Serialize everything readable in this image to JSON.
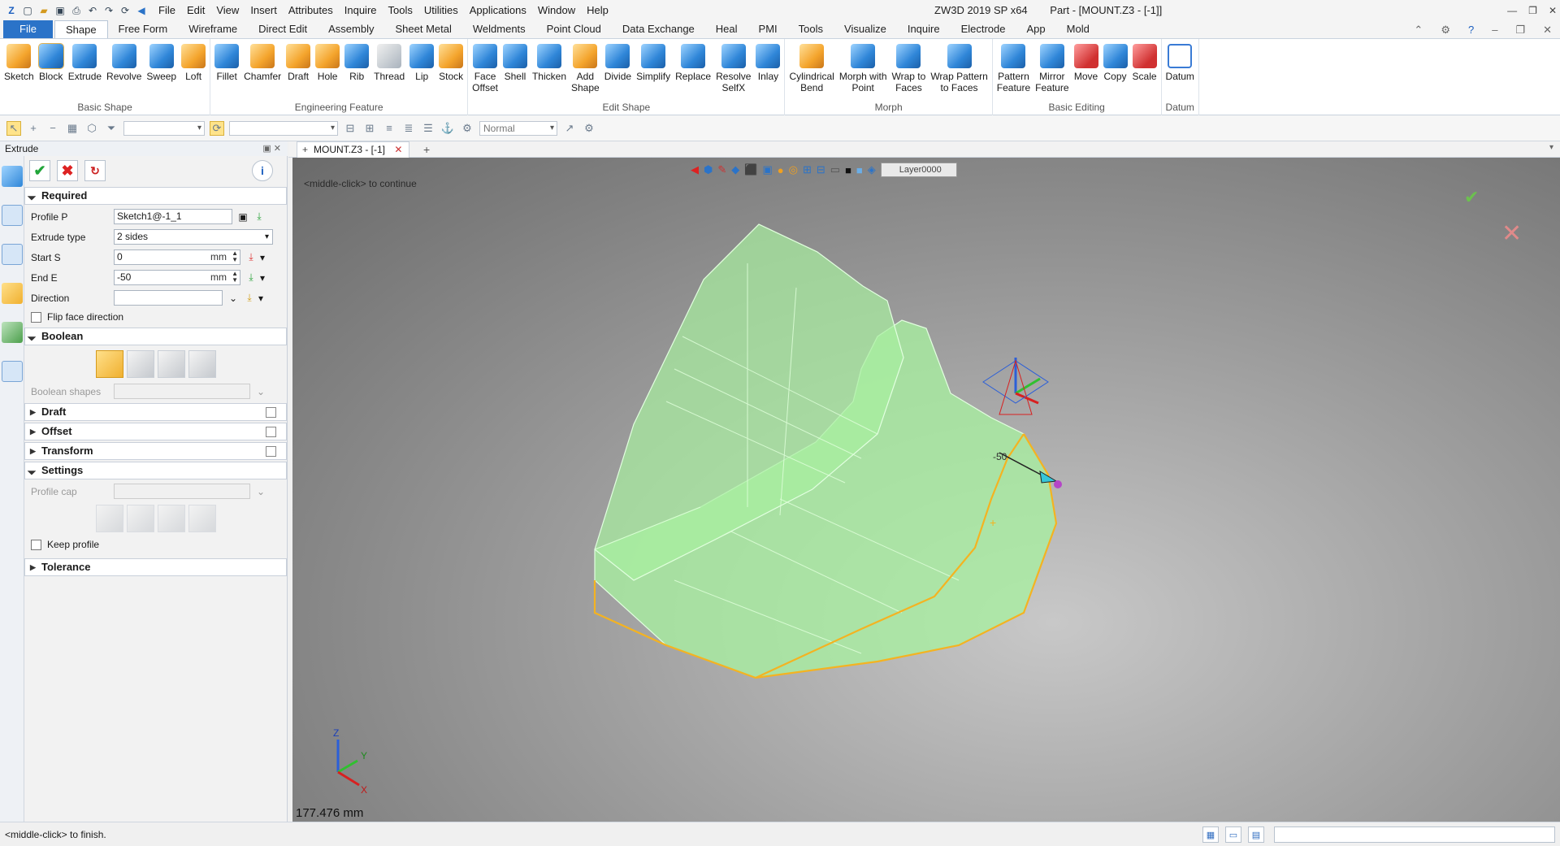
{
  "app": {
    "window_title": "ZW3D 2019 SP x64",
    "doc_title": "Part - [MOUNT.Z3 - [-1]]"
  },
  "menu": [
    "File",
    "Edit",
    "View",
    "Insert",
    "Attributes",
    "Inquire",
    "Tools",
    "Utilities",
    "Applications",
    "Window",
    "Help"
  ],
  "tabs": [
    "File",
    "Shape",
    "Free Form",
    "Wireframe",
    "Direct Edit",
    "Assembly",
    "Sheet Metal",
    "Weldments",
    "Point Cloud",
    "Data Exchange",
    "Heal",
    "PMI",
    "Tools",
    "Visualize",
    "Inquire",
    "Electrode",
    "App",
    "Mold"
  ],
  "ribbon": {
    "groups": [
      {
        "label": "Basic Shape",
        "buttons": [
          {
            "label": "Sketch",
            "icon": "sketch-icon",
            "color": "orange"
          },
          {
            "label": "Block",
            "icon": "block-icon",
            "color": "blue"
          },
          {
            "label": "Extrude",
            "icon": "extrude-icon",
            "color": "blue"
          },
          {
            "label": "Revolve",
            "icon": "revolve-icon",
            "color": "blue"
          },
          {
            "label": "Sweep",
            "icon": "sweep-icon",
            "color": "blue"
          },
          {
            "label": "Loft",
            "icon": "loft-icon",
            "color": "orange"
          }
        ]
      },
      {
        "label": "Engineering Feature",
        "buttons": [
          {
            "label": "Fillet",
            "icon": "fillet-icon",
            "color": "blue"
          },
          {
            "label": "Chamfer",
            "icon": "chamfer-icon",
            "color": "orange"
          },
          {
            "label": "Draft",
            "icon": "draft-icon",
            "color": "orange"
          },
          {
            "label": "Hole",
            "icon": "hole-icon",
            "color": "orange"
          },
          {
            "label": "Rib",
            "icon": "rib-icon",
            "color": "blue"
          },
          {
            "label": "Thread",
            "icon": "thread-icon",
            "color": "grey"
          },
          {
            "label": "Lip",
            "icon": "lip-icon",
            "color": "blue"
          },
          {
            "label": "Stock",
            "icon": "stock-icon",
            "color": "orange"
          }
        ]
      },
      {
        "label": "Edit Shape",
        "buttons": [
          {
            "label": "Face\nOffset",
            "icon": "face-offset-icon",
            "color": "blue"
          },
          {
            "label": "Shell",
            "icon": "shell-icon",
            "color": "blue"
          },
          {
            "label": "Thicken",
            "icon": "thicken-icon",
            "color": "blue"
          },
          {
            "label": "Add\nShape",
            "icon": "add-shape-icon",
            "color": "orange"
          },
          {
            "label": "Divide",
            "icon": "divide-icon",
            "color": "blue"
          },
          {
            "label": "Simplify",
            "icon": "simplify-icon",
            "color": "blue"
          },
          {
            "label": "Replace",
            "icon": "replace-icon",
            "color": "blue"
          },
          {
            "label": "Resolve\nSelfX",
            "icon": "resolve-selfx-icon",
            "color": "blue"
          },
          {
            "label": "Inlay",
            "icon": "inlay-icon",
            "color": "blue"
          }
        ]
      },
      {
        "label": "Morph",
        "buttons": [
          {
            "label": "Cylindrical\nBend",
            "icon": "cylindrical-bend-icon",
            "color": "orange"
          },
          {
            "label": "Morph with\nPoint",
            "icon": "morph-point-icon",
            "color": "blue"
          },
          {
            "label": "Wrap to\nFaces",
            "icon": "wrap-faces-icon",
            "color": "blue"
          },
          {
            "label": "Wrap Pattern\nto Faces",
            "icon": "wrap-pattern-icon",
            "color": "blue"
          }
        ]
      },
      {
        "label": "Basic Editing",
        "buttons": [
          {
            "label": "Pattern\nFeature",
            "icon": "pattern-feature-icon",
            "color": "blue"
          },
          {
            "label": "Mirror\nFeature",
            "icon": "mirror-feature-icon",
            "color": "blue"
          },
          {
            "label": "Move",
            "icon": "move-icon",
            "color": "red"
          },
          {
            "label": "Copy",
            "icon": "copy-icon",
            "color": "blue"
          },
          {
            "label": "Scale",
            "icon": "scale-icon",
            "color": "red"
          }
        ]
      },
      {
        "label": "Datum",
        "buttons": [
          {
            "label": "Datum",
            "icon": "datum-icon",
            "color": "datum"
          }
        ]
      }
    ]
  },
  "toolbar2": {
    "render_mode": "Normal"
  },
  "panel": {
    "title": "Extrude",
    "required": "Required",
    "profile_label": "Profile P",
    "profile_value": "Sketch1@-1_1",
    "extrude_type_label": "Extrude type",
    "extrude_type_value": "2 sides",
    "start_label": "Start S",
    "start_value": "0",
    "start_unit": "mm",
    "end_label": "End E",
    "end_value": "-50",
    "end_unit": "mm",
    "direction_label": "Direction",
    "flip_label": "Flip face direction",
    "boolean": "Boolean",
    "boolean_shapes": "Boolean shapes",
    "draft": "Draft",
    "offset": "Offset",
    "transform": "Transform",
    "settings": "Settings",
    "profile_cap": "Profile cap",
    "keep_profile": "Keep profile",
    "tolerance": "Tolerance"
  },
  "doc": {
    "tab": "MOUNT.Z3 - [-1]"
  },
  "viewport": {
    "prompt": "<middle-click> to continue",
    "distance": "177.476 mm",
    "layer": "Layer0000",
    "dim_label": "-50",
    "triad": {
      "x": "X",
      "y": "Y",
      "z": "Z"
    },
    "preview_color": "#9ff29a",
    "edge_color": "#f4b321"
  },
  "status": {
    "text": "<middle-click> to finish."
  }
}
